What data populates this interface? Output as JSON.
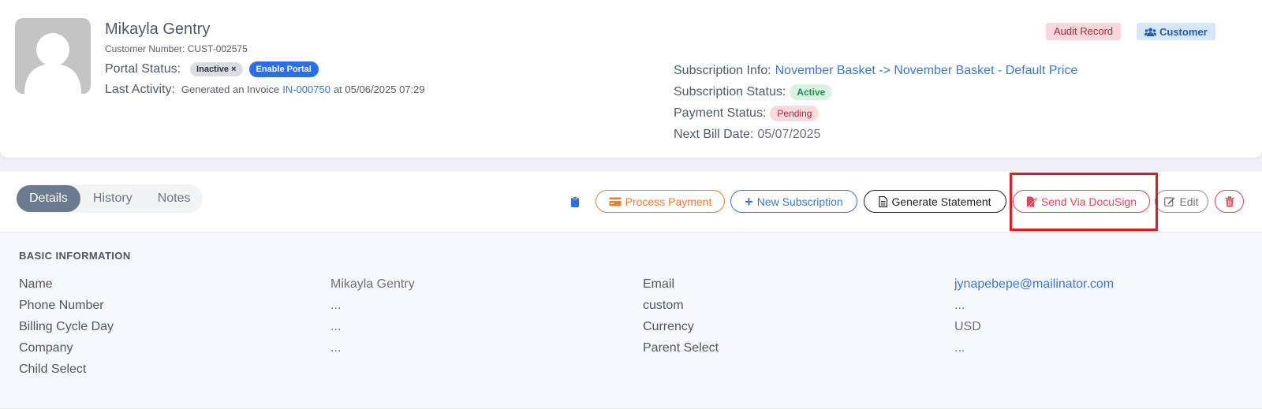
{
  "header": {
    "name": "Mikayla Gentry",
    "customer_number": "Customer Number: CUST-002575",
    "portal_status_label": "Portal Status:",
    "portal_status_badge": "Inactive ×",
    "enable_portal_label": "Enable Portal",
    "last_activity_label": "Last Activity:",
    "last_activity_prefix": "Generated an Invoice",
    "last_activity_link": "IN-000750",
    "last_activity_suffix": "at 05/06/2025 07:29",
    "tags": {
      "audit": "Audit Record",
      "customer": "Customer"
    },
    "subscription": {
      "info_label": "Subscription Info:",
      "info_value": "November Basket -> November Basket - Default Price",
      "status_label": "Subscription Status:",
      "status_value": "Active",
      "payment_label": "Payment Status:",
      "payment_value": "Pending",
      "next_bill_label": "Next Bill Date:",
      "next_bill_value": "05/07/2025"
    }
  },
  "tabs": [
    {
      "label": "Details",
      "active": true
    },
    {
      "label": "History",
      "active": false
    },
    {
      "label": "Notes",
      "active": false
    }
  ],
  "actions": {
    "process_payment": "Process Payment",
    "new_subscription": "New Subscription",
    "generate_statement": "Generate Statement",
    "send_docusign": "Send Via DocuSign",
    "edit": "Edit"
  },
  "basic_info": {
    "title": "BASIC INFORMATION",
    "left": [
      {
        "label": "Name",
        "value": "Mikayla Gentry"
      },
      {
        "label": "Phone Number",
        "value": "..."
      },
      {
        "label": "Billing Cycle Day",
        "value": "..."
      },
      {
        "label": "Company",
        "value": "..."
      },
      {
        "label": "Child Select",
        "value": ""
      }
    ],
    "right": [
      {
        "label": "Email",
        "value": "jynapebepe@mailinator.com"
      },
      {
        "label": "custom",
        "value": "..."
      },
      {
        "label": "Currency",
        "value": "USD"
      },
      {
        "label": "Parent Select",
        "value": "..."
      }
    ]
  },
  "colors": {
    "accent_blue": "#3a78d8",
    "orange": "#f07b2e",
    "danger": "#e0455b",
    "highlight": "#e01b24"
  }
}
